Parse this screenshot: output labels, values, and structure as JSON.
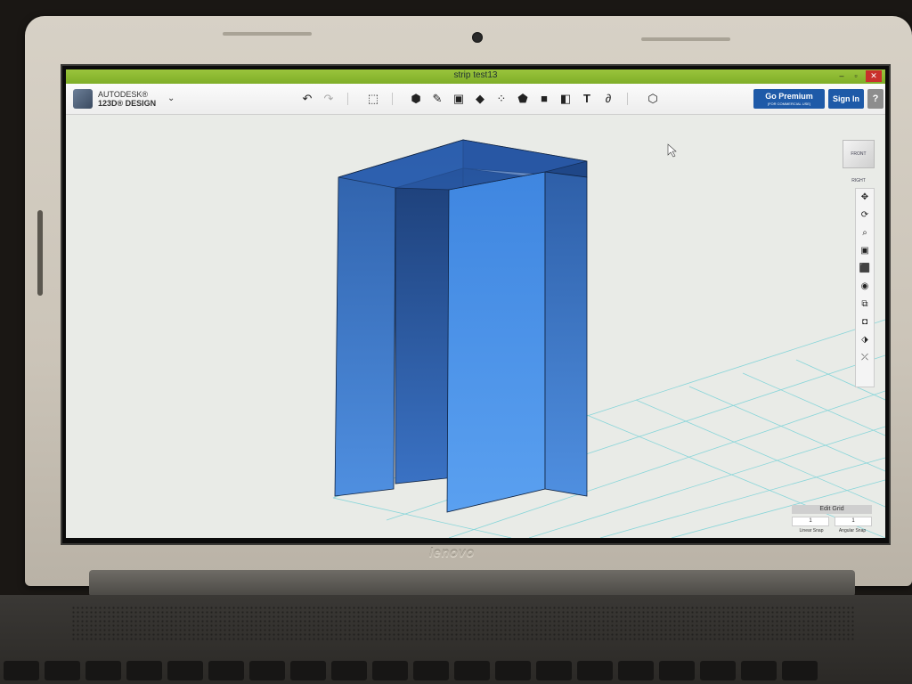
{
  "window": {
    "title": "strip test13",
    "controls": [
      "–",
      "▫",
      "✕"
    ]
  },
  "app": {
    "brand_line1": "AUTODESK®",
    "brand_line2": "123D® DESIGN",
    "menu_chevron": "⌄"
  },
  "toolbar": {
    "tools": [
      {
        "name": "undo-icon",
        "glyph": "↶"
      },
      {
        "name": "redo-icon",
        "glyph": "↷"
      },
      {
        "name": "transform-icon",
        "glyph": "⬚"
      },
      {
        "name": "primitives-icon",
        "glyph": "⬢"
      },
      {
        "name": "sketch-icon",
        "glyph": "✎"
      },
      {
        "name": "construct-icon",
        "glyph": "▣"
      },
      {
        "name": "modify-icon",
        "glyph": "◆"
      },
      {
        "name": "pattern-icon",
        "glyph": "⁘"
      },
      {
        "name": "grouping-icon",
        "glyph": "⬟"
      },
      {
        "name": "combine-icon",
        "glyph": "■"
      },
      {
        "name": "measure-icon",
        "glyph": "◧"
      },
      {
        "name": "text-icon",
        "glyph": "T"
      },
      {
        "name": "snap-icon",
        "glyph": "∂"
      },
      {
        "name": "material-icon",
        "glyph": "⬡"
      }
    ],
    "premium_label": "Go Premium",
    "premium_sub": "(FOR COMMERCIAL USE)",
    "signin_label": "Sign In",
    "help_label": "?"
  },
  "viewport": {
    "navcube_label": "FRONT RIGHT",
    "nav_tools": [
      {
        "name": "pan-icon",
        "glyph": "✥"
      },
      {
        "name": "orbit-icon",
        "glyph": "⟳"
      },
      {
        "name": "zoom-icon",
        "glyph": "⌕"
      },
      {
        "name": "fit-icon",
        "glyph": "▣"
      },
      {
        "name": "view-cube-icon",
        "glyph": "⬛"
      },
      {
        "name": "visibility-icon",
        "glyph": "◉"
      },
      {
        "name": "materials-outline-icon",
        "glyph": "⧉"
      },
      {
        "name": "camera-icon",
        "glyph": "◘"
      },
      {
        "name": "hide-icon",
        "glyph": "⬗"
      },
      {
        "name": "show-hide-sketch-icon",
        "glyph": "⤫"
      }
    ],
    "grid": {
      "title": "Edit Grid",
      "linear_snap_value": "1",
      "angular_snap_value": "1",
      "linear_snap_label": "Linear Snap",
      "angular_snap_label": "Angular Snap"
    }
  },
  "laptop": {
    "brand": "lenovo"
  },
  "colors": {
    "titlebar": "#8ab832",
    "accent_button": "#1e5aa8",
    "model_blue": "#3d7fd6",
    "grid_line": "#6fd0d6"
  }
}
